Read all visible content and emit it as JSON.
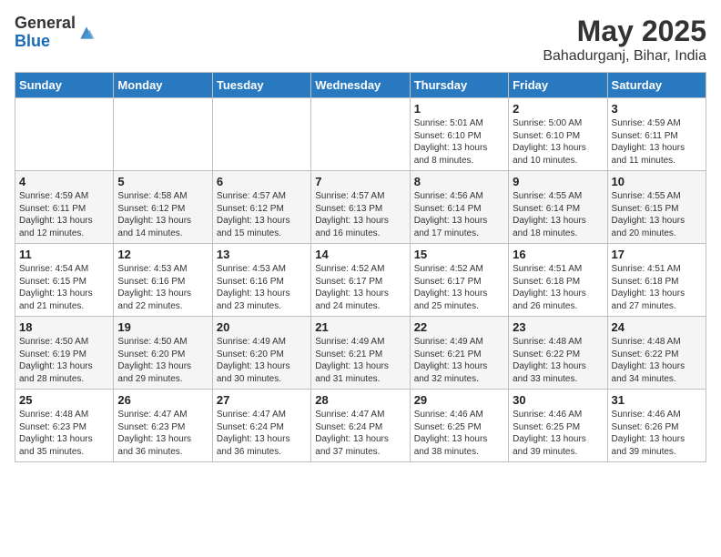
{
  "header": {
    "logo_general": "General",
    "logo_blue": "Blue",
    "month_title": "May 2025",
    "location": "Bahadurganj, Bihar, India"
  },
  "weekdays": [
    "Sunday",
    "Monday",
    "Tuesday",
    "Wednesday",
    "Thursday",
    "Friday",
    "Saturday"
  ],
  "weeks": [
    [
      {
        "day": "",
        "info": ""
      },
      {
        "day": "",
        "info": ""
      },
      {
        "day": "",
        "info": ""
      },
      {
        "day": "",
        "info": ""
      },
      {
        "day": "1",
        "info": "Sunrise: 5:01 AM\nSunset: 6:10 PM\nDaylight: 13 hours\nand 8 minutes."
      },
      {
        "day": "2",
        "info": "Sunrise: 5:00 AM\nSunset: 6:10 PM\nDaylight: 13 hours\nand 10 minutes."
      },
      {
        "day": "3",
        "info": "Sunrise: 4:59 AM\nSunset: 6:11 PM\nDaylight: 13 hours\nand 11 minutes."
      }
    ],
    [
      {
        "day": "4",
        "info": "Sunrise: 4:59 AM\nSunset: 6:11 PM\nDaylight: 13 hours\nand 12 minutes."
      },
      {
        "day": "5",
        "info": "Sunrise: 4:58 AM\nSunset: 6:12 PM\nDaylight: 13 hours\nand 14 minutes."
      },
      {
        "day": "6",
        "info": "Sunrise: 4:57 AM\nSunset: 6:12 PM\nDaylight: 13 hours\nand 15 minutes."
      },
      {
        "day": "7",
        "info": "Sunrise: 4:57 AM\nSunset: 6:13 PM\nDaylight: 13 hours\nand 16 minutes."
      },
      {
        "day": "8",
        "info": "Sunrise: 4:56 AM\nSunset: 6:14 PM\nDaylight: 13 hours\nand 17 minutes."
      },
      {
        "day": "9",
        "info": "Sunrise: 4:55 AM\nSunset: 6:14 PM\nDaylight: 13 hours\nand 18 minutes."
      },
      {
        "day": "10",
        "info": "Sunrise: 4:55 AM\nSunset: 6:15 PM\nDaylight: 13 hours\nand 20 minutes."
      }
    ],
    [
      {
        "day": "11",
        "info": "Sunrise: 4:54 AM\nSunset: 6:15 PM\nDaylight: 13 hours\nand 21 minutes."
      },
      {
        "day": "12",
        "info": "Sunrise: 4:53 AM\nSunset: 6:16 PM\nDaylight: 13 hours\nand 22 minutes."
      },
      {
        "day": "13",
        "info": "Sunrise: 4:53 AM\nSunset: 6:16 PM\nDaylight: 13 hours\nand 23 minutes."
      },
      {
        "day": "14",
        "info": "Sunrise: 4:52 AM\nSunset: 6:17 PM\nDaylight: 13 hours\nand 24 minutes."
      },
      {
        "day": "15",
        "info": "Sunrise: 4:52 AM\nSunset: 6:17 PM\nDaylight: 13 hours\nand 25 minutes."
      },
      {
        "day": "16",
        "info": "Sunrise: 4:51 AM\nSunset: 6:18 PM\nDaylight: 13 hours\nand 26 minutes."
      },
      {
        "day": "17",
        "info": "Sunrise: 4:51 AM\nSunset: 6:18 PM\nDaylight: 13 hours\nand 27 minutes."
      }
    ],
    [
      {
        "day": "18",
        "info": "Sunrise: 4:50 AM\nSunset: 6:19 PM\nDaylight: 13 hours\nand 28 minutes."
      },
      {
        "day": "19",
        "info": "Sunrise: 4:50 AM\nSunset: 6:20 PM\nDaylight: 13 hours\nand 29 minutes."
      },
      {
        "day": "20",
        "info": "Sunrise: 4:49 AM\nSunset: 6:20 PM\nDaylight: 13 hours\nand 30 minutes."
      },
      {
        "day": "21",
        "info": "Sunrise: 4:49 AM\nSunset: 6:21 PM\nDaylight: 13 hours\nand 31 minutes."
      },
      {
        "day": "22",
        "info": "Sunrise: 4:49 AM\nSunset: 6:21 PM\nDaylight: 13 hours\nand 32 minutes."
      },
      {
        "day": "23",
        "info": "Sunrise: 4:48 AM\nSunset: 6:22 PM\nDaylight: 13 hours\nand 33 minutes."
      },
      {
        "day": "24",
        "info": "Sunrise: 4:48 AM\nSunset: 6:22 PM\nDaylight: 13 hours\nand 34 minutes."
      }
    ],
    [
      {
        "day": "25",
        "info": "Sunrise: 4:48 AM\nSunset: 6:23 PM\nDaylight: 13 hours\nand 35 minutes."
      },
      {
        "day": "26",
        "info": "Sunrise: 4:47 AM\nSunset: 6:23 PM\nDaylight: 13 hours\nand 36 minutes."
      },
      {
        "day": "27",
        "info": "Sunrise: 4:47 AM\nSunset: 6:24 PM\nDaylight: 13 hours\nand 36 minutes."
      },
      {
        "day": "28",
        "info": "Sunrise: 4:47 AM\nSunset: 6:24 PM\nDaylight: 13 hours\nand 37 minutes."
      },
      {
        "day": "29",
        "info": "Sunrise: 4:46 AM\nSunset: 6:25 PM\nDaylight: 13 hours\nand 38 minutes."
      },
      {
        "day": "30",
        "info": "Sunrise: 4:46 AM\nSunset: 6:25 PM\nDaylight: 13 hours\nand 39 minutes."
      },
      {
        "day": "31",
        "info": "Sunrise: 4:46 AM\nSunset: 6:26 PM\nDaylight: 13 hours\nand 39 minutes."
      }
    ]
  ]
}
